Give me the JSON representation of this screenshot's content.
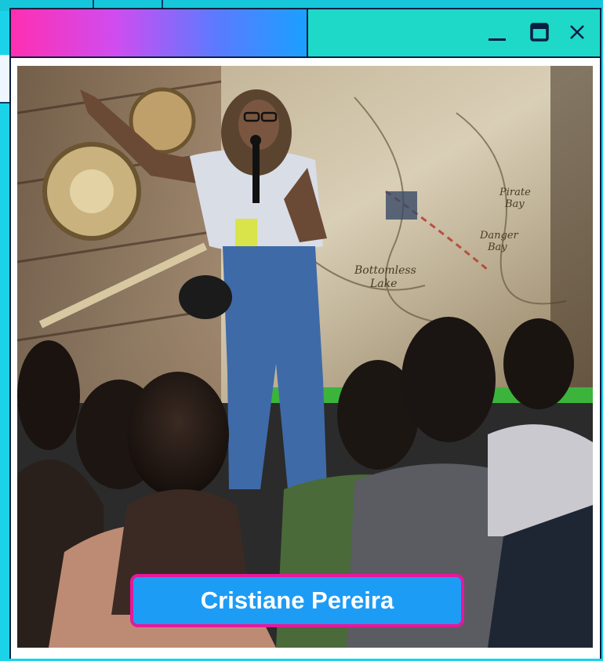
{
  "window": {
    "controls": {
      "minimize_icon": "minimize-icon",
      "maximize_icon": "maximize-icon",
      "close_icon": "close-icon"
    },
    "colors": {
      "frame": "#0a1f3f",
      "titlebar_gradient_start": "#ff2fb1",
      "titlebar_gradient_end": "#1aa0ff",
      "titlebar_right": "#1ed8c8",
      "background": "#1bd3e8"
    }
  },
  "photo": {
    "subject": "Speaker on stage holding a microphone and pointing, audience seated in foreground, treasure map projected behind"
  },
  "caption": {
    "name": "Cristiane Pereira",
    "background": "#1d9cf5",
    "border": "#e5199a"
  }
}
